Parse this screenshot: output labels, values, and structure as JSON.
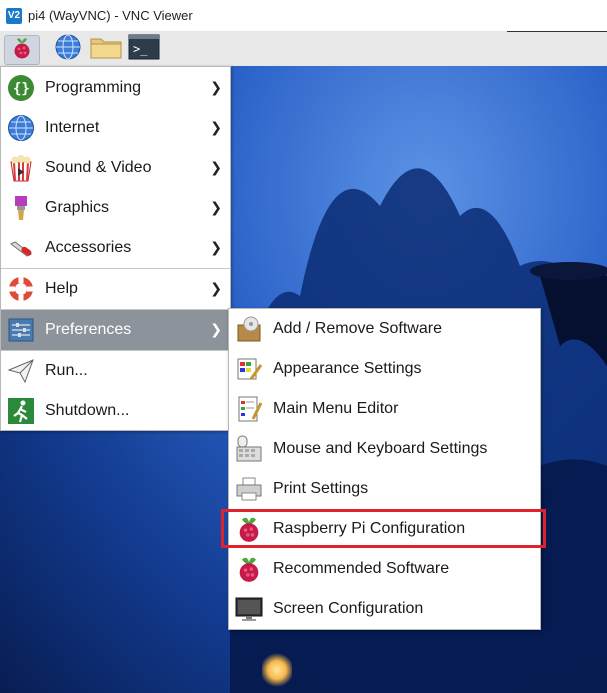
{
  "window": {
    "title": "pi4 (WayVNC) - VNC Viewer",
    "logo_text": "V2"
  },
  "taskbar": {
    "buttons": [
      {
        "name": "raspberry-menu-button",
        "icon": "raspberry-icon"
      },
      {
        "name": "browser-button",
        "icon": "globe-icon"
      },
      {
        "name": "file-manager-button",
        "icon": "folder-icon"
      },
      {
        "name": "terminal-button",
        "icon": "terminal-icon"
      }
    ]
  },
  "main_menu": {
    "items": [
      {
        "label": "Programming",
        "icon": "code-braces-icon",
        "has_submenu": true
      },
      {
        "label": "Internet",
        "icon": "globe-icon",
        "has_submenu": true
      },
      {
        "label": "Sound & Video",
        "icon": "popcorn-icon",
        "has_submenu": true
      },
      {
        "label": "Graphics",
        "icon": "paintbrush-icon",
        "has_submenu": true
      },
      {
        "label": "Accessories",
        "icon": "pocket-knife-icon",
        "has_submenu": true
      },
      {
        "label": "Help",
        "icon": "lifebuoy-icon",
        "has_submenu": true
      },
      {
        "label": "Preferences",
        "icon": "sliders-icon",
        "has_submenu": true,
        "selected": true
      },
      {
        "label": "Run...",
        "icon": "paper-plane-icon",
        "has_submenu": false
      },
      {
        "label": "Shutdown...",
        "icon": "running-man-icon",
        "has_submenu": false
      }
    ]
  },
  "preferences_submenu": {
    "items": [
      {
        "label": "Add / Remove Software",
        "icon": "software-box-icon"
      },
      {
        "label": "Appearance Settings",
        "icon": "palette-icon"
      },
      {
        "label": "Main Menu Editor",
        "icon": "menu-editor-icon"
      },
      {
        "label": "Mouse and Keyboard Settings",
        "icon": "mouse-keyboard-icon"
      },
      {
        "label": "Print Settings",
        "icon": "printer-icon"
      },
      {
        "label": "Raspberry Pi Configuration",
        "icon": "raspberry-icon",
        "highlighted": true
      },
      {
        "label": "Recommended Software",
        "icon": "raspberry-icon"
      },
      {
        "label": "Screen Configuration",
        "icon": "monitor-icon"
      }
    ]
  },
  "colors": {
    "selection": "#8c939b",
    "highlight_box": "#e0212e",
    "raspberry": "#c51a4a"
  }
}
